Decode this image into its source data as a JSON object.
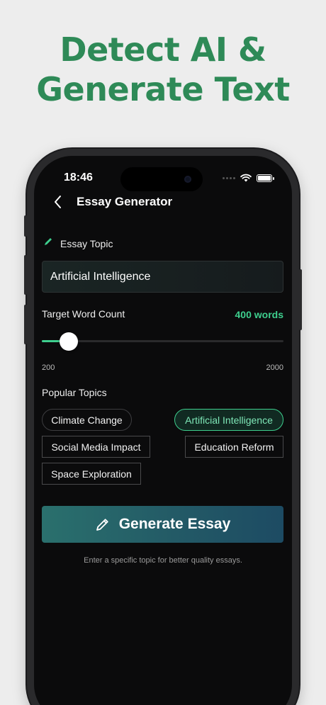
{
  "promo": {
    "headline_line1": "Detect AI &",
    "headline_line2": "Generate Text"
  },
  "colors": {
    "accent": "#3ecf8e",
    "headline": "#2e8a57",
    "screen_bg": "#0b0b0c"
  },
  "status_bar": {
    "time": "18:46",
    "icons": [
      "cellular-dots-icon",
      "wifi-icon",
      "battery-icon"
    ]
  },
  "nav": {
    "back_icon": "chevron-left-icon",
    "title": "Essay Generator"
  },
  "essay_topic": {
    "icon": "pencil-icon",
    "label": "Essay Topic",
    "value": "Artificial Intelligence"
  },
  "word_count": {
    "label": "Target Word Count",
    "value_text": "400 words",
    "value": 400,
    "min": 200,
    "max": 2000,
    "min_label": "200",
    "max_label": "2000"
  },
  "popular_topics": {
    "label": "Popular Topics",
    "items": [
      {
        "label": "Climate Change",
        "selected": false
      },
      {
        "label": "Artificial Intelligence",
        "selected": true
      },
      {
        "label": "Social Media Impact",
        "selected": false
      },
      {
        "label": "Education Reform",
        "selected": false
      },
      {
        "label": "Space Exploration",
        "selected": false
      }
    ]
  },
  "generate_button": {
    "icon": "pencil-icon",
    "label": "Generate Essay"
  },
  "hint": "Enter a specific topic for better quality essays."
}
